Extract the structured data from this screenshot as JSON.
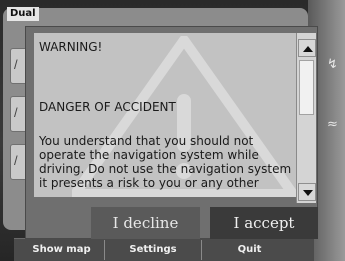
{
  "app": {
    "brand": "Dual"
  },
  "warning": {
    "title": "WARNING!",
    "heading": "DANGER OF ACCIDENT",
    "lines": [
      "You understand that you should not",
      "operate the navigation system while",
      "driving. Do not use the navigation system if",
      "it presents a risk to you or any other"
    ]
  },
  "buttons": {
    "decline": "I decline",
    "accept": "I accept"
  },
  "bottom_bar": {
    "show_map": "Show map",
    "settings": "Settings",
    "quit": "Quit"
  },
  "scroll": {
    "position": 0.0
  },
  "icons": [
    "warning-triangle-icon",
    "scroll-up-icon",
    "scroll-down-icon"
  ]
}
